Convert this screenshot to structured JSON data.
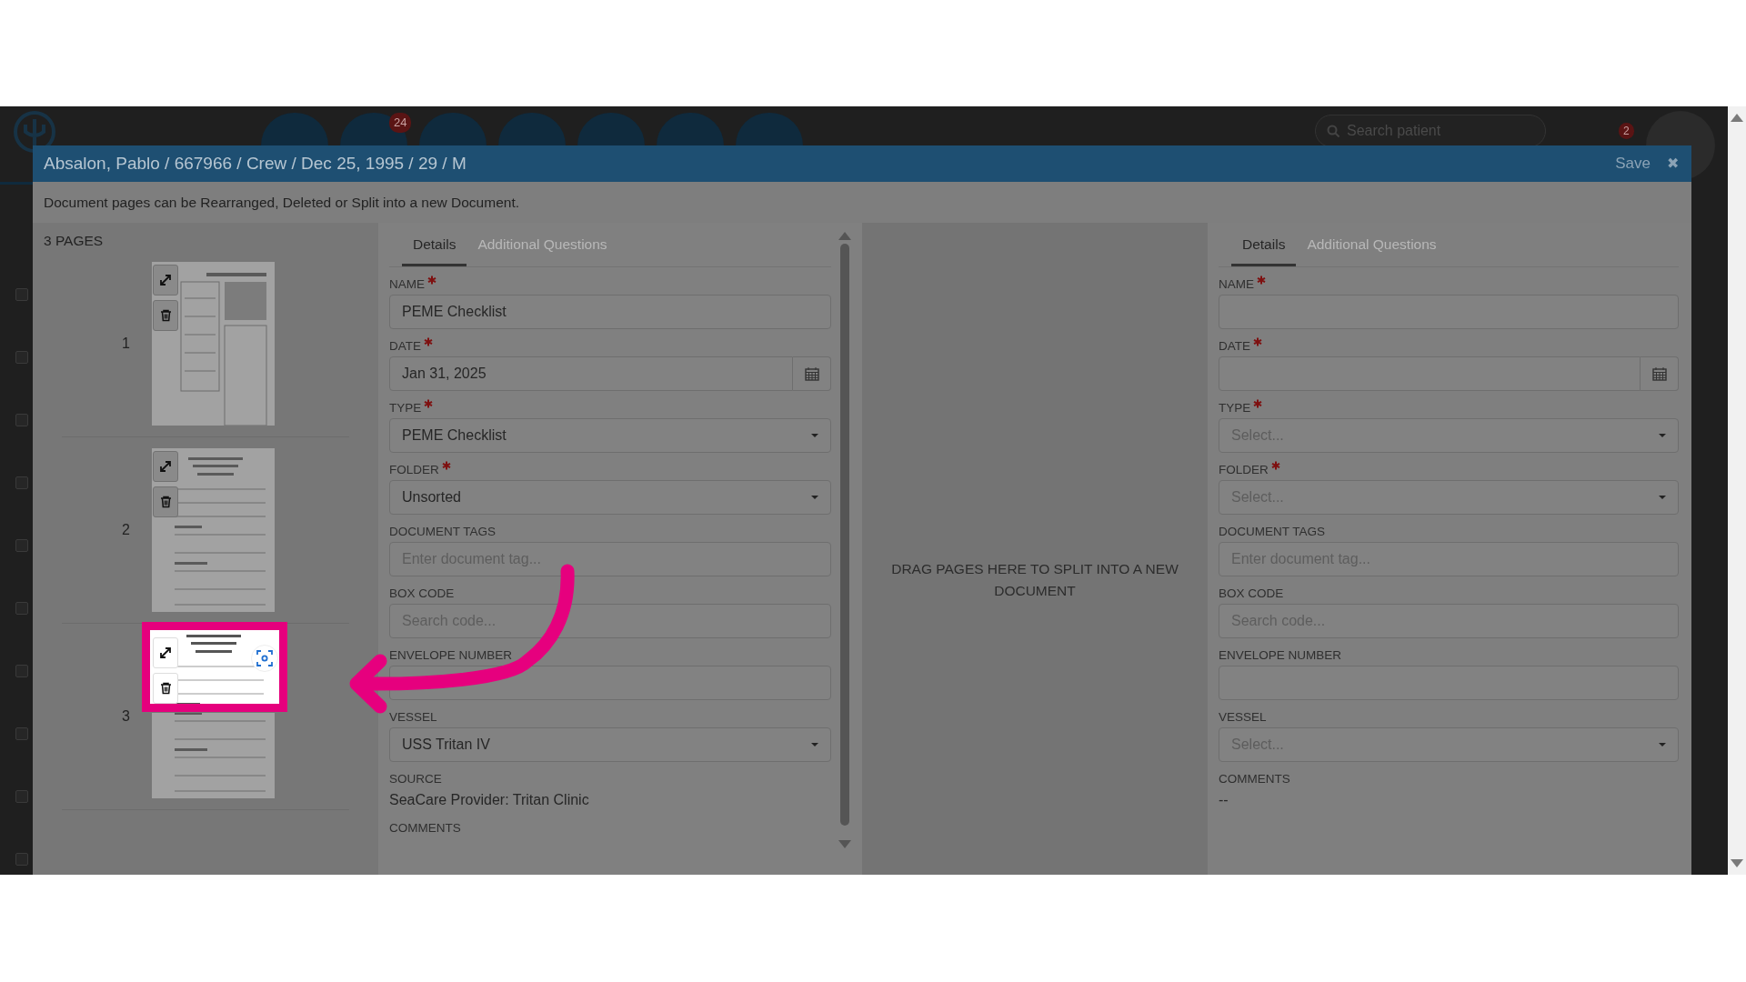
{
  "background_app": {
    "nav_badge": "24",
    "search": {
      "placeholder": "Search patient"
    },
    "notification_count": "2",
    "row_checkboxes": [
      {
        "checked": false
      },
      {
        "checked": false
      },
      {
        "checked": false
      },
      {
        "checked": false
      },
      {
        "checked": false
      },
      {
        "checked": false
      },
      {
        "checked": false
      },
      {
        "checked": false
      },
      {
        "checked": false
      },
      {
        "checked": false
      }
    ]
  },
  "modal": {
    "title": "Absalon, Pablo / 667966 / Crew / Dec 25, 1995 / 29 / M",
    "save": "Save",
    "close": "✖",
    "description": "Document pages can be Rearranged, Deleted or Split into a new Document.",
    "pages_count": "3 PAGES",
    "pages": [
      {
        "number": "1",
        "highlighted": false
      },
      {
        "number": "2",
        "highlighted": false
      },
      {
        "number": "3",
        "highlighted": true
      }
    ],
    "current_form": {
      "tabs": [
        {
          "label": "Details",
          "selected": true
        },
        {
          "label": "Additional Questions",
          "selected": false
        }
      ],
      "fields": [
        {
          "kind": "text",
          "label": "NAME",
          "required": true,
          "value": "PEME Checklist"
        },
        {
          "kind": "date",
          "label": "DATE",
          "required": true,
          "value": "Jan 31, 2025"
        },
        {
          "kind": "select",
          "label": "TYPE",
          "required": true,
          "value": "PEME Checklist"
        },
        {
          "kind": "select",
          "label": "FOLDER",
          "required": true,
          "value": "Unsorted"
        },
        {
          "kind": "text",
          "label": "DOCUMENT TAGS",
          "required": false,
          "placeholder": "Enter document tag..."
        },
        {
          "kind": "text",
          "label": "BOX CODE",
          "required": false,
          "placeholder": "Search code..."
        },
        {
          "kind": "text",
          "label": "ENVELOPE NUMBER",
          "required": false
        },
        {
          "kind": "select",
          "label": "VESSEL",
          "required": false,
          "value": "USS Tritan IV"
        },
        {
          "kind": "static",
          "label": "SOURCE",
          "required": false,
          "value": "SeaCare Provider: Tritan Clinic"
        },
        {
          "kind": "static",
          "label": "COMMENTS",
          "required": false
        }
      ]
    },
    "drop_zone": "DRAG PAGES HERE TO SPLIT INTO A NEW DOCUMENT",
    "new_form": {
      "tabs": [
        {
          "label": "Details",
          "selected": true
        },
        {
          "label": "Additional Questions",
          "selected": false
        }
      ],
      "fields": [
        {
          "kind": "text",
          "label": "NAME",
          "required": true
        },
        {
          "kind": "date",
          "label": "DATE",
          "required": true
        },
        {
          "kind": "select",
          "label": "TYPE",
          "required": true,
          "placeholder": "Select..."
        },
        {
          "kind": "select",
          "label": "FOLDER",
          "required": true,
          "placeholder": "Select..."
        },
        {
          "kind": "text",
          "label": "DOCUMENT TAGS",
          "required": false,
          "placeholder": "Enter document tag..."
        },
        {
          "kind": "text",
          "label": "BOX CODE",
          "required": false,
          "placeholder": "Search code..."
        },
        {
          "kind": "text",
          "label": "ENVELOPE NUMBER",
          "required": false
        },
        {
          "kind": "select",
          "label": "VESSEL",
          "required": false,
          "placeholder": "Select..."
        },
        {
          "kind": "static",
          "label": "COMMENTS",
          "required": false,
          "value": "--"
        }
      ]
    }
  }
}
